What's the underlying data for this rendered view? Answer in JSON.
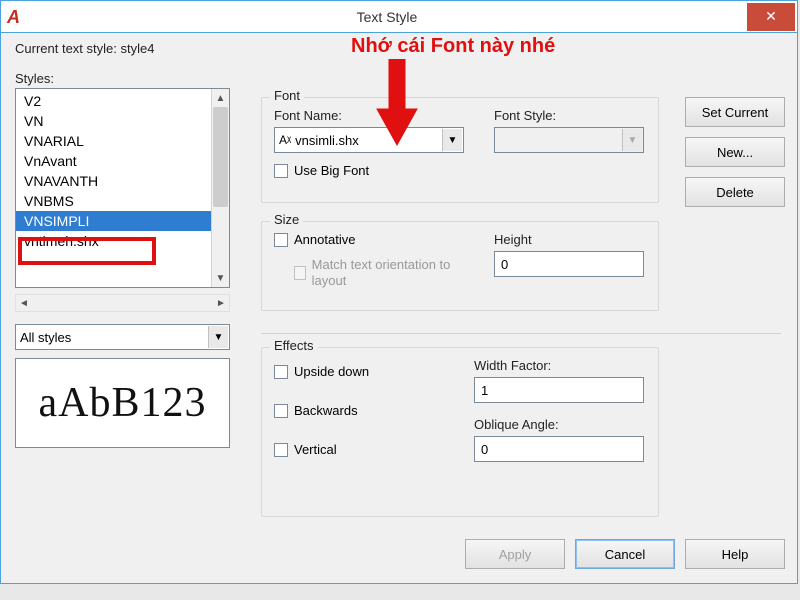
{
  "window": {
    "title": "Text Style"
  },
  "current_style": {
    "label": "Current text style:",
    "value": "style4"
  },
  "styles_label": "Styles:",
  "styles_list": [
    "V2",
    "VN",
    "VNARIAL",
    "VnAvant",
    "VNAVANTH",
    "VNBMS",
    "VNSIMPLI",
    "vntimeh.shx"
  ],
  "selected_style": "VNSIMPLI",
  "filter": {
    "value": "All styles"
  },
  "preview_text": "aAbB123",
  "font": {
    "group": "Font",
    "name_label": "Font Name:",
    "name_value": "vnsimli.shx",
    "style_label": "Font Style:",
    "style_value": "",
    "big_font": "Use Big Font"
  },
  "size": {
    "group": "Size",
    "annotative": "Annotative",
    "match": "Match text orientation to layout",
    "height_label": "Height",
    "height_value": "0"
  },
  "effects": {
    "group": "Effects",
    "upside": "Upside down",
    "backwards": "Backwards",
    "vertical": "Vertical",
    "wf_label": "Width Factor:",
    "wf_value": "1",
    "oa_label": "Oblique Angle:",
    "oa_value": "0"
  },
  "buttons": {
    "set_current": "Set Current",
    "new": "New...",
    "delete": "Delete",
    "apply": "Apply",
    "cancel": "Cancel",
    "help": "Help"
  },
  "annotation": "Nhớ cái Font này nhé"
}
